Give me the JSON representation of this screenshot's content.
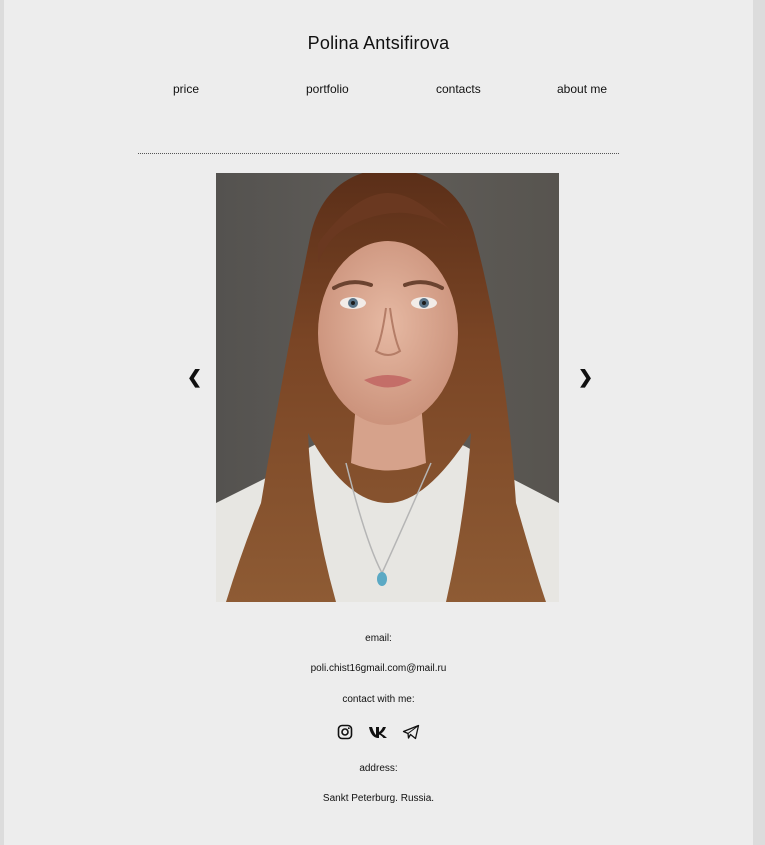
{
  "header": {
    "title": "Polina Antsifirova"
  },
  "nav": {
    "items": [
      {
        "label": "price"
      },
      {
        "label": "portfolio"
      },
      {
        "label": "contacts"
      },
      {
        "label": "about me"
      }
    ]
  },
  "carousel": {
    "prev_symbol": "❮",
    "next_symbol": "❯",
    "photo_icon": "portrait-photo"
  },
  "contacts": {
    "email_label": "email:",
    "email": "poli.chist16gmail.com@mail.ru",
    "contact_label": "contact with me:",
    "social": [
      {
        "icon": "instagram-icon"
      },
      {
        "icon": "vk-icon"
      },
      {
        "icon": "telegram-icon"
      }
    ],
    "address_label": "address:",
    "address": "Sankt Peterburg. Russia."
  },
  "colors": {
    "background": "#ededed",
    "outer_background": "#dcdcdc",
    "text": "#111111"
  }
}
